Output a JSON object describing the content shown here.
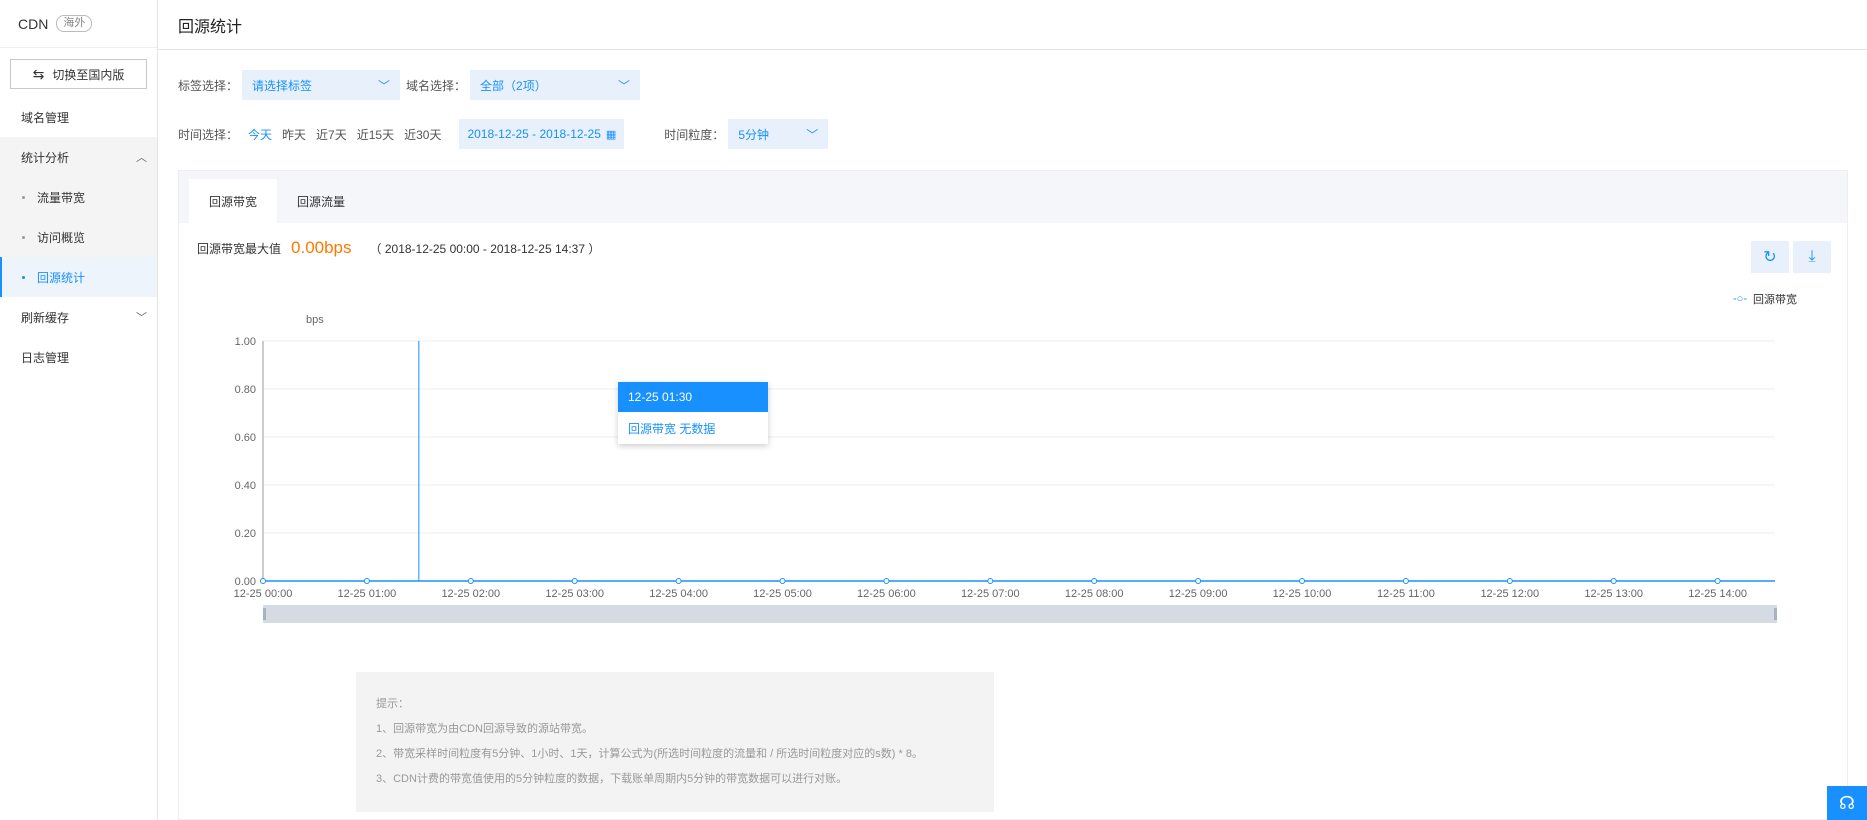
{
  "sidebar": {
    "product": "CDN",
    "region_tag": "海外",
    "switch_label": "切换至国内版",
    "items": [
      {
        "label": "域名管理"
      },
      {
        "label": "统计分析"
      },
      {
        "label": "流量带宽"
      },
      {
        "label": "访问概览"
      },
      {
        "label": "回源统计"
      },
      {
        "label": "刷新缓存"
      },
      {
        "label": "日志管理"
      }
    ],
    "active": "回源统计"
  },
  "header": {
    "title": "回源统计"
  },
  "filters": {
    "tag_label": "标签选择：",
    "tag_value": "请选择标签",
    "domain_label": "域名选择：",
    "domain_value": "全部（2项）",
    "time_label": "时间选择：",
    "quick_ranges": [
      "今天",
      "昨天",
      "近7天",
      "近15天",
      "近30天"
    ],
    "active_quick": "今天",
    "date_range": "2018-12-25 - 2018-12-25",
    "granularity_label": "时间粒度：",
    "granularity_value": "5分钟"
  },
  "tabs": [
    {
      "label": "回源带宽"
    },
    {
      "label": "回源流量"
    }
  ],
  "active_tab": "回源带宽",
  "metric": {
    "label": "回源带宽最大值",
    "value": "0.00bps",
    "range": "（ 2018-12-25 00:00 - 2018-12-25 14:37 ）"
  },
  "icons": {
    "refresh": "refresh-icon",
    "download": "download-icon",
    "help": "headset-icon"
  },
  "colors": {
    "accent": "#1890ff",
    "highlight": "#ff7a00"
  },
  "chart_data": {
    "type": "line",
    "ylabel": "bps",
    "ylim": [
      0,
      1
    ],
    "y_ticks": [
      "1.00",
      "0.80",
      "0.60",
      "0.40",
      "0.20",
      "0.00"
    ],
    "categories": [
      "12-25 00:00",
      "12-25 01:00",
      "12-25 02:00",
      "12-25 03:00",
      "12-25 04:00",
      "12-25 05:00",
      "12-25 06:00",
      "12-25 07:00",
      "12-25 08:00",
      "12-25 09:00",
      "12-25 10:00",
      "12-25 11:00",
      "12-25 12:00",
      "12-25 13:00",
      "12-25 14:00"
    ],
    "series": [
      {
        "name": "回源带宽",
        "values": [
          0,
          0,
          0,
          0,
          0,
          0,
          0,
          0,
          0,
          0,
          0,
          0,
          0,
          0,
          0
        ]
      }
    ],
    "cursor_x": "12-25 01:30",
    "legend": "top-right"
  },
  "tooltip": {
    "time": "12-25 01:30",
    "text": "回源带宽 无数据"
  },
  "tips": {
    "title": "提示：",
    "lines": [
      "1、回源带宽为由CDN回源导致的源站带宽。",
      "2、带宽采样时间粒度有5分钟、1小时、1天，计算公式为(所选时间粒度的流量和 / 所选时间粒度对应的s数) * 8。",
      "3、CDN计费的带宽值使用的5分钟粒度的数据，下载账单周期内5分钟的带宽数据可以进行对账。"
    ]
  }
}
